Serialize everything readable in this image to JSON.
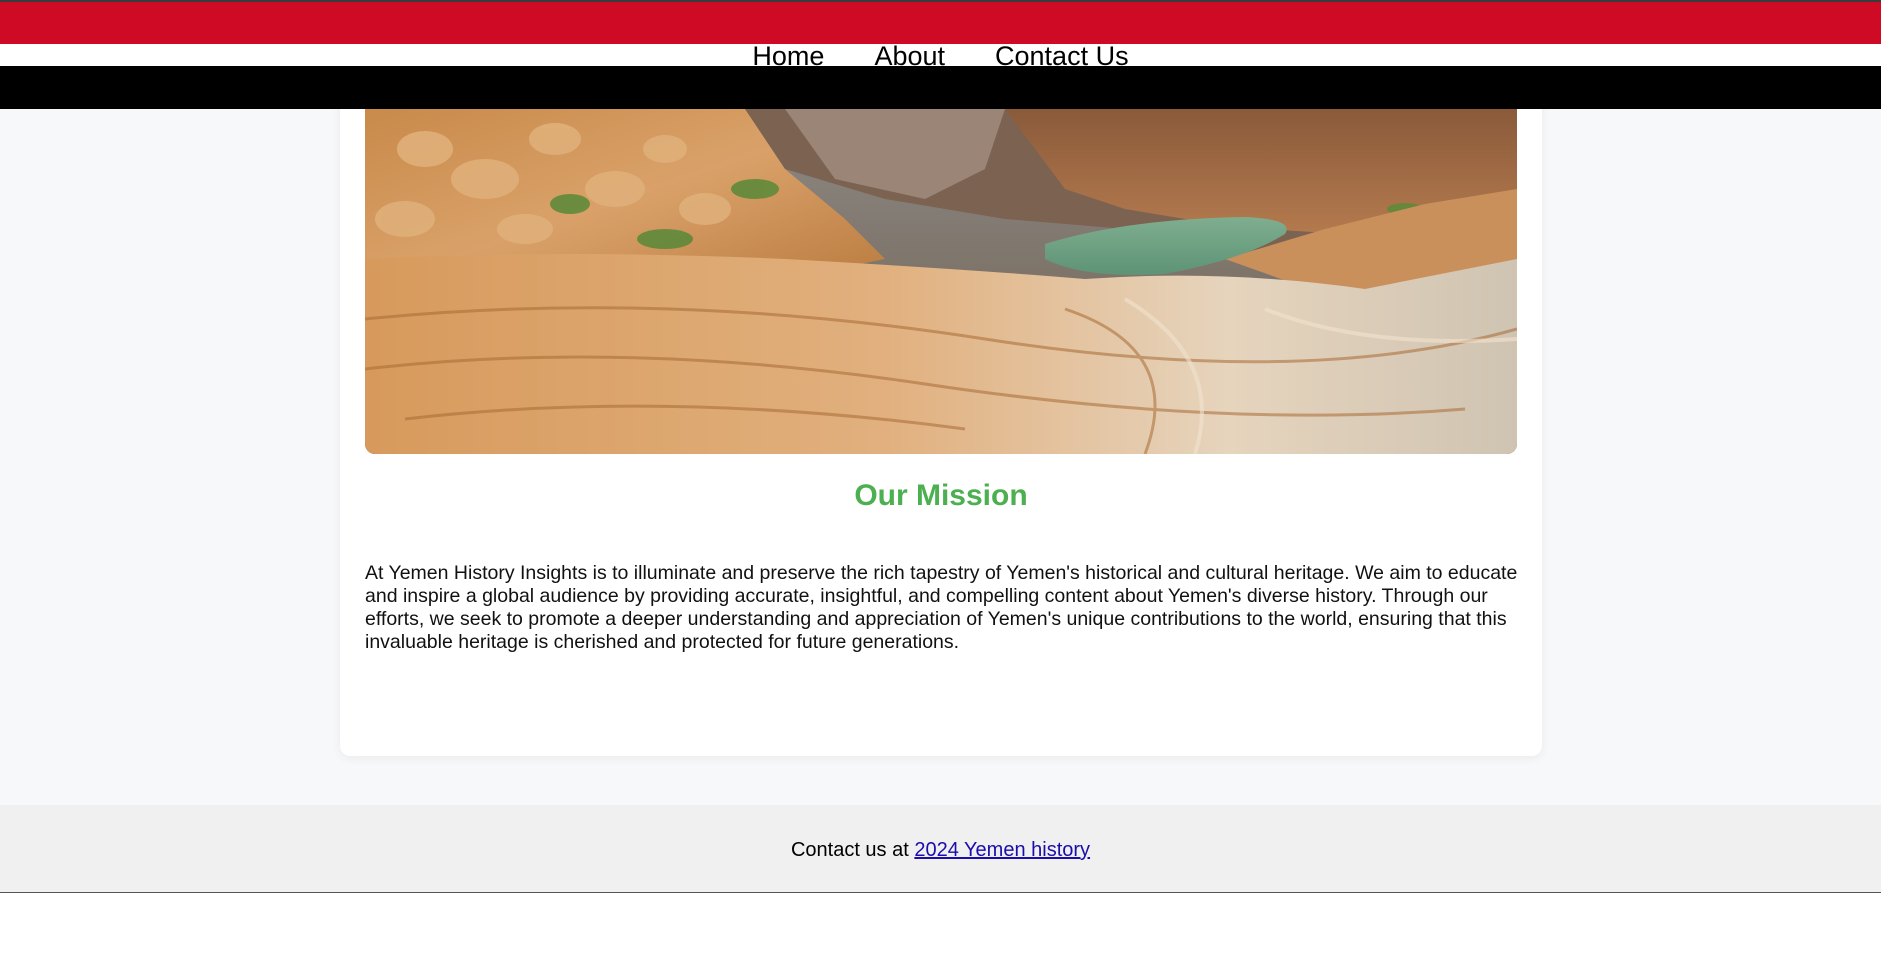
{
  "nav": {
    "items": [
      {
        "label": "Home"
      },
      {
        "label": "About"
      },
      {
        "label": "Contact Us"
      }
    ]
  },
  "hero": {
    "image": "canyon-landscape-with-green-pool"
  },
  "mission": {
    "title": "Our Mission",
    "body": "At Yemen History Insights is to illuminate and preserve the rich tapestry of Yemen's historical and cultural heritage. We aim to educate and inspire a global audience by providing accurate, insightful, and compelling content about Yemen's diverse history. Through our efforts, we seek to promote a deeper understanding and appreciation of Yemen's unique contributions to the world, ensuring that this invaluable heritage is cherished and protected for future generations."
  },
  "footer": {
    "prefix": "Contact us at ",
    "link_text": "2024 Yemen history"
  },
  "colors": {
    "flag_red": "#ce0a24",
    "flag_white": "#ffffff",
    "flag_black": "#000000",
    "mission_title": "#4caf50",
    "link": "#1a0dab"
  }
}
